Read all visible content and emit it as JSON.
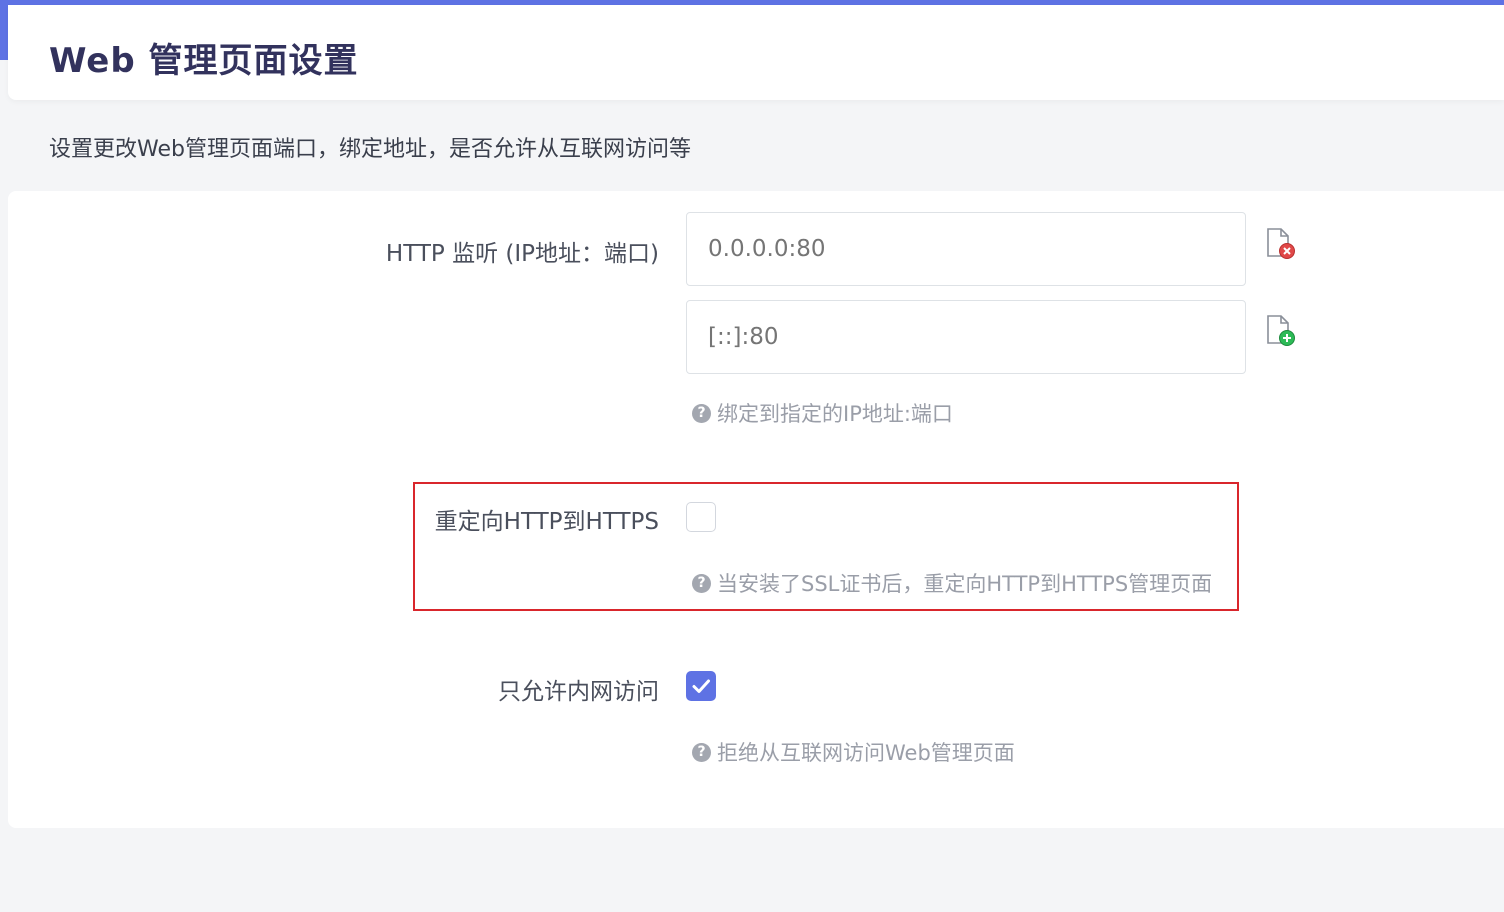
{
  "header": {
    "title": "Web 管理页面设置"
  },
  "description": "设置更改Web管理页面端口，绑定地址，是否允许从互联网访问等",
  "http_listen": {
    "label": "HTTP 监听 (IP地址：端口)",
    "inputs": [
      {
        "value": "",
        "placeholder": "0.0.0.0:80",
        "action_icon": "file-remove-icon"
      },
      {
        "value": "",
        "placeholder": "[::]:80",
        "action_icon": "file-add-icon"
      }
    ],
    "help": "绑定到指定的IP地址:端口"
  },
  "redirect_https": {
    "label": "重定向HTTP到HTTPS",
    "checked": false,
    "help": "当安装了SSL证书后，重定向HTTP到HTTPS管理页面"
  },
  "lan_only": {
    "label": "只允许内网访问",
    "checked": true,
    "help": "拒绝从互联网访问Web管理页面"
  },
  "colors": {
    "accent": "#5e72e4",
    "highlight": "#d9262c",
    "remove": "#e04848",
    "add": "#2dbb57"
  }
}
